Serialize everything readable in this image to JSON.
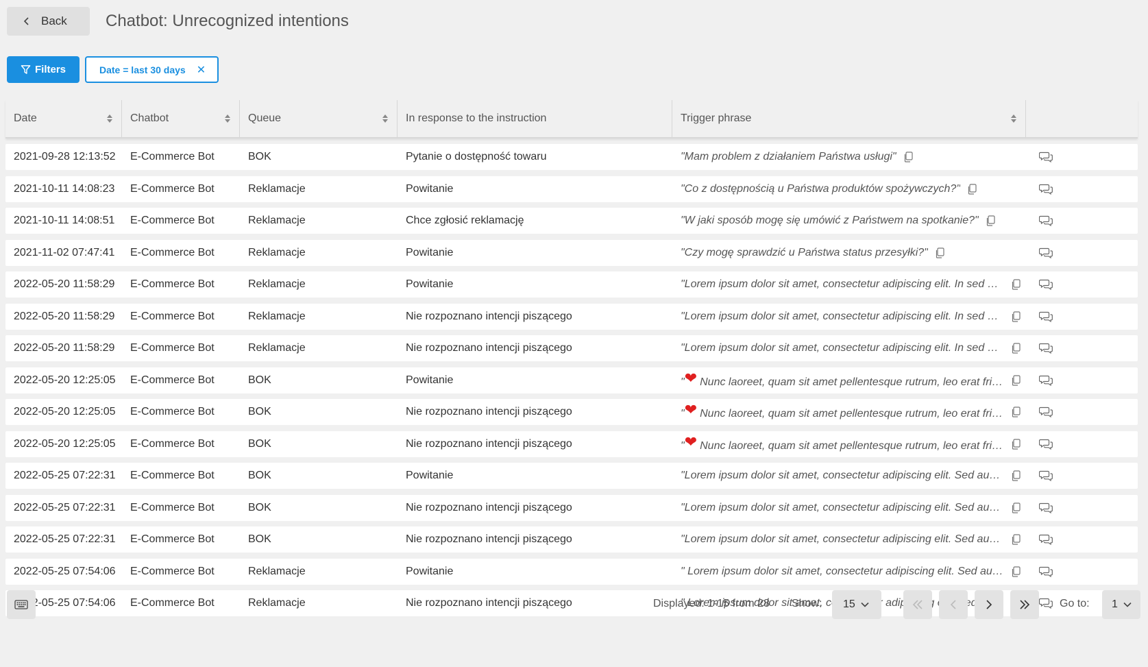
{
  "header": {
    "back_label": "Back",
    "title": "Chatbot: Unrecognized intentions"
  },
  "filters": {
    "button_label": "Filters",
    "chip_label": "Date = last 30 days",
    "chip_close": "✕"
  },
  "table": {
    "columns": [
      "Date",
      "Chatbot",
      "Queue",
      "In response to the instruction",
      "Trigger phrase"
    ],
    "rows": [
      {
        "date": "2021-09-28 12:13:52",
        "bot": "E-Commerce Bot",
        "queue": "BOK",
        "instr": "Pytanie o dostępność towaru",
        "phrase": "\"Mam problem z działaniem Państwa usługi\"",
        "heart": false
      },
      {
        "date": "2021-10-11 14:08:23",
        "bot": "E-Commerce Bot",
        "queue": "Reklamacje",
        "instr": "Powitanie",
        "phrase": "\"Co z dostępnością u Państwa produktów spożywczych?\"",
        "heart": false
      },
      {
        "date": "2021-10-11 14:08:51",
        "bot": "E-Commerce Bot",
        "queue": "Reklamacje",
        "instr": "Chce zgłosić reklamację",
        "phrase": "\"W jaki sposób mogę się umówić z Państwem na spotkanie?\"",
        "heart": false
      },
      {
        "date": "2021-11-02 07:47:41",
        "bot": "E-Commerce Bot",
        "queue": "Reklamacje",
        "instr": "Powitanie",
        "phrase": "\"Czy mogę sprawdzić u Państwa status przesyłki?\"",
        "heart": false
      },
      {
        "date": "2022-05-20 11:58:29",
        "bot": "E-Commerce Bot",
        "queue": "Reklamacje",
        "instr": "Powitanie",
        "phrase": "\"Lorem ipsum dolor sit amet, consectetur adipiscing elit. In sed dui p...",
        "heart": false
      },
      {
        "date": "2022-05-20 11:58:29",
        "bot": "E-Commerce Bot",
        "queue": "Reklamacje",
        "instr": "Nie rozpoznano intencji piszącego",
        "phrase": "\"Lorem ipsum dolor sit amet, consectetur adipiscing elit. In sed dui p...",
        "heart": false
      },
      {
        "date": "2022-05-20 11:58:29",
        "bot": "E-Commerce Bot",
        "queue": "Reklamacje",
        "instr": "Nie rozpoznano intencji piszącego",
        "phrase": "\"Lorem ipsum dolor sit amet, consectetur adipiscing elit. In sed dui p...",
        "heart": false
      },
      {
        "date": "2022-05-20 12:25:05",
        "bot": "E-Commerce Bot",
        "queue": "BOK",
        "instr": "Powitanie",
        "phrase": "Nunc laoreet, quam sit amet pellentesque rutrum, leo erat fringi...",
        "heart": true
      },
      {
        "date": "2022-05-20 12:25:05",
        "bot": "E-Commerce Bot",
        "queue": "BOK",
        "instr": "Nie rozpoznano intencji piszącego",
        "phrase": "Nunc laoreet, quam sit amet pellentesque rutrum, leo erat fringi...",
        "heart": true
      },
      {
        "date": "2022-05-20 12:25:05",
        "bot": "E-Commerce Bot",
        "queue": "BOK",
        "instr": "Nie rozpoznano intencji piszącego",
        "phrase": "Nunc laoreet, quam sit amet pellentesque rutrum, leo erat fringi...",
        "heart": true
      },
      {
        "date": "2022-05-25 07:22:31",
        "bot": "E-Commerce Bot",
        "queue": "BOK",
        "instr": "Powitanie",
        "phrase": "\"Lorem ipsum dolor sit amet, consectetur adipiscing elit. Sed augue ...",
        "heart": false
      },
      {
        "date": "2022-05-25 07:22:31",
        "bot": "E-Commerce Bot",
        "queue": "BOK",
        "instr": "Nie rozpoznano intencji piszącego",
        "phrase": "\"Lorem ipsum dolor sit amet, consectetur adipiscing elit. Sed augue ...",
        "heart": false
      },
      {
        "date": "2022-05-25 07:22:31",
        "bot": "E-Commerce Bot",
        "queue": "BOK",
        "instr": "Nie rozpoznano intencji piszącego",
        "phrase": "\"Lorem ipsum dolor sit amet, consectetur adipiscing elit. Sed augue ...",
        "heart": false
      },
      {
        "date": "2022-05-25 07:54:06",
        "bot": "E-Commerce Bot",
        "queue": "Reklamacje",
        "instr": "Powitanie",
        "phrase": "\" Lorem ipsum dolor sit amet, consectetur adipiscing elit. Sed augue ...",
        "heart": false
      },
      {
        "date": "2022-05-25 07:54:06",
        "bot": "E-Commerce Bot",
        "queue": "Reklamacje",
        "instr": "Nie rozpoznano intencji piszącego",
        "phrase": "\" Lorem ipsum dolor sit amet, consectetur adipiscing elit. Sed augue ...",
        "heart": false
      }
    ],
    "heart_prefix": "\"",
    "heart_symbol": "❤"
  },
  "pagination": {
    "displayed": "Displayed: 1-15 from 28",
    "show_label": "Show:",
    "page_size": "15",
    "goto_label": "Go to:",
    "goto_value": "1"
  }
}
